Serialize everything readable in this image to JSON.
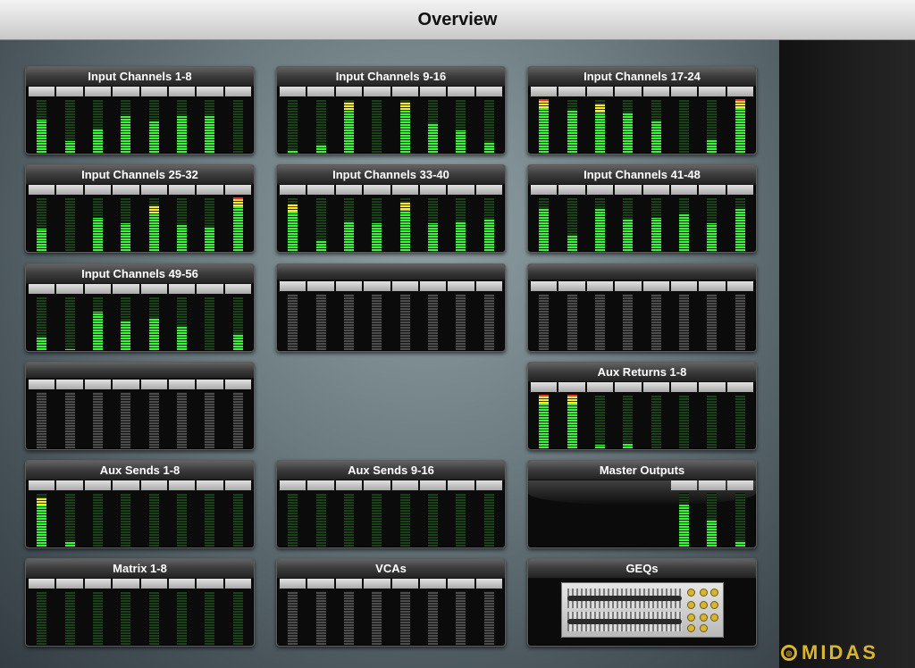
{
  "header": {
    "title": "Overview"
  },
  "colors": {
    "meter_green": "#3cf23c",
    "meter_peak": "#f5ec3a",
    "meter_clip": "#ff2a2a",
    "tab_grey": "#c4c4c4",
    "logo_gold": "#d8b52a"
  },
  "panels": [
    {
      "title": "Input Channels 1-8",
      "levels": [
        0.62,
        0.22,
        0.45,
        0.68,
        0.58,
        0.68,
        0.68,
        0.0
      ]
    },
    {
      "title": "Input Channels 9-16",
      "levels": [
        0.05,
        0.15,
        0.95,
        0.0,
        0.95,
        0.55,
        0.42,
        0.2
      ]
    },
    {
      "title": "Input Channels 17-24",
      "levels": [
        0.98,
        0.78,
        0.92,
        0.75,
        0.6,
        0.0,
        0.25,
        0.98
      ]
    },
    {
      "title": "Input Channels 25-32",
      "levels": [
        0.42,
        0.0,
        0.62,
        0.52,
        0.85,
        0.48,
        0.45,
        0.98
      ]
    },
    {
      "title": "Input Channels 33-40",
      "levels": [
        0.88,
        0.2,
        0.55,
        0.52,
        0.92,
        0.52,
        0.55,
        0.6
      ]
    },
    {
      "title": "Input Channels 41-48",
      "levels": [
        0.8,
        0.3,
        0.78,
        0.6,
        0.62,
        0.68,
        0.52,
        0.78
      ]
    },
    {
      "title": "Input Channels 49-56",
      "levels": [
        0.25,
        0.02,
        0.72,
        0.55,
        0.6,
        0.45,
        0.0,
        0.3
      ]
    },
    {
      "title": "",
      "levels": []
    },
    {
      "title": "",
      "levels": []
    },
    {
      "title": "",
      "levels": []
    },
    {
      "title": "Aux Returns 1-8",
      "levels": [
        0.98,
        0.98,
        0.06,
        0.08,
        0.0,
        0.0,
        0.0,
        0.0
      ]
    },
    {
      "title": "Aux Sends 1-8",
      "levels": [
        0.92,
        0.08,
        0.0,
        0.0,
        0.0,
        0.0,
        0.0,
        0.0
      ]
    },
    {
      "title": "Aux Sends 9-16",
      "levels": [
        0.0,
        0.0,
        0.0,
        0.0,
        0.0,
        0.0,
        0.0,
        0.0
      ]
    },
    {
      "title": "Master Outputs",
      "levels": [
        0.78,
        0.5,
        0.1
      ]
    },
    {
      "title": "Matrix 1-8",
      "levels": [
        0.0,
        0.0,
        0.0,
        0.0,
        0.0,
        0.0,
        0.0,
        0.0
      ]
    },
    {
      "title": "VCAs",
      "levels": []
    },
    {
      "title": "GEQs",
      "image": "geq-rack-image"
    }
  ],
  "logo": {
    "text": "MIDAS",
    "icon": "midas-logo-icon"
  }
}
